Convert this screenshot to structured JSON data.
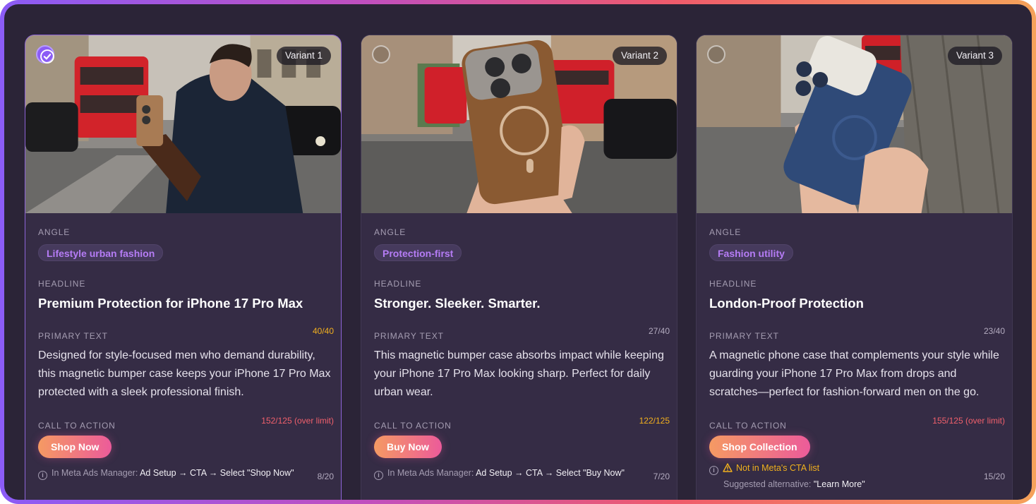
{
  "labels": {
    "angle": "ANGLE",
    "headline": "HEADLINE",
    "primary_text": "PRIMARY TEXT",
    "call_to_action": "CALL TO ACTION"
  },
  "colors": {
    "accent_purple": "#8b5cf6",
    "chip_text": "#b57cf5",
    "warn": "#f2b01e",
    "over_limit": "#f0606c",
    "cta_gradient_start": "#f59a63",
    "cta_gradient_end": "#ec5b9a"
  },
  "variants": [
    {
      "badge": "Variant 1",
      "selected": true,
      "angle": "Lifestyle urban fashion",
      "headline": "Premium Protection for iPhone 17 Pro Max",
      "headline_count": "40/40",
      "primary_text": "Designed for style-focused men who demand durability, this magnetic bumper case keeps your iPhone 17 Pro Max protected with a sleek professional finish.",
      "primary_count": "152/125 (over limit)",
      "cta": "Shop Now",
      "meta_prefix": "In Meta Ads Manager:",
      "meta_path": "Ad Setup → CTA → Select \"Shop Now\"",
      "cta_count": "8/20",
      "image": "Man in navy coat and leather gloves holding phone with tan case on London street with red double-decker bus"
    },
    {
      "badge": "Variant 2",
      "selected": false,
      "angle": "Protection-first",
      "headline": "Stronger. Sleeker. Smarter.",
      "headline_count": "27/40",
      "primary_text": "This magnetic bumper case absorbs impact while keeping your iPhone 17 Pro Max looking sharp. Perfect for daily urban wear.",
      "primary_count": "122/125",
      "cta": "Buy Now",
      "meta_prefix": "In Meta Ads Manager:",
      "meta_path": "Ad Setup → CTA → Select \"Buy Now\"",
      "cta_count": "7/20",
      "image": "Hand holding phone with brown leather case on rainy London street with red buses and black taxi"
    },
    {
      "badge": "Variant 3",
      "selected": false,
      "angle": "Fashion utility",
      "headline": "London-Proof Protection",
      "headline_count": "23/40",
      "primary_text": "A magnetic phone case that complements your style while guarding your iPhone 17 Pro Max from drops and scratches—perfect for fashion-forward men on the go.",
      "primary_count": "155/125 (over limit)",
      "cta": "Shop Collection",
      "warning": "Not in Meta's CTA list",
      "suggest_prefix": "Suggested alternative:",
      "suggest_value": "\"Learn More\"",
      "cta_count": "15/20",
      "image": "Hands holding phone with blue leather case on wet London street with red bus"
    }
  ]
}
